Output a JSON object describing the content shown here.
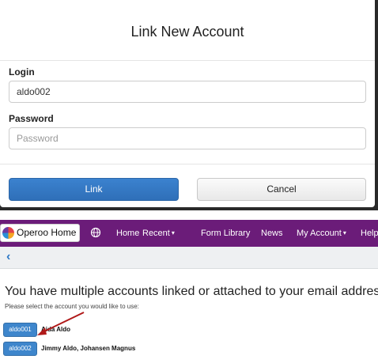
{
  "modal": {
    "title": "Link New Account",
    "login_label": "Login",
    "login_value": "aldo002",
    "password_label": "Password",
    "password_placeholder": "Password",
    "link_button": "Link",
    "cancel_button": "Cancel"
  },
  "navbar": {
    "home_label": "Operoo Home",
    "items": [
      "Home",
      "Recent",
      "Form Library",
      "News",
      "My Account",
      "Help"
    ]
  },
  "page": {
    "heading": "You have multiple accounts linked or attached to your email address.",
    "subtext": "Please select the account you would like to use:",
    "accounts": [
      {
        "id": "aldo001",
        "name": "Aida Aldo"
      },
      {
        "id": "aldo002",
        "name": "Jimmy Aldo, Johansen Magnus"
      }
    ]
  },
  "colors": {
    "nav_purple": "#6b1c79",
    "primary_blue": "#3278c4",
    "arrow_red": "#b01919"
  }
}
